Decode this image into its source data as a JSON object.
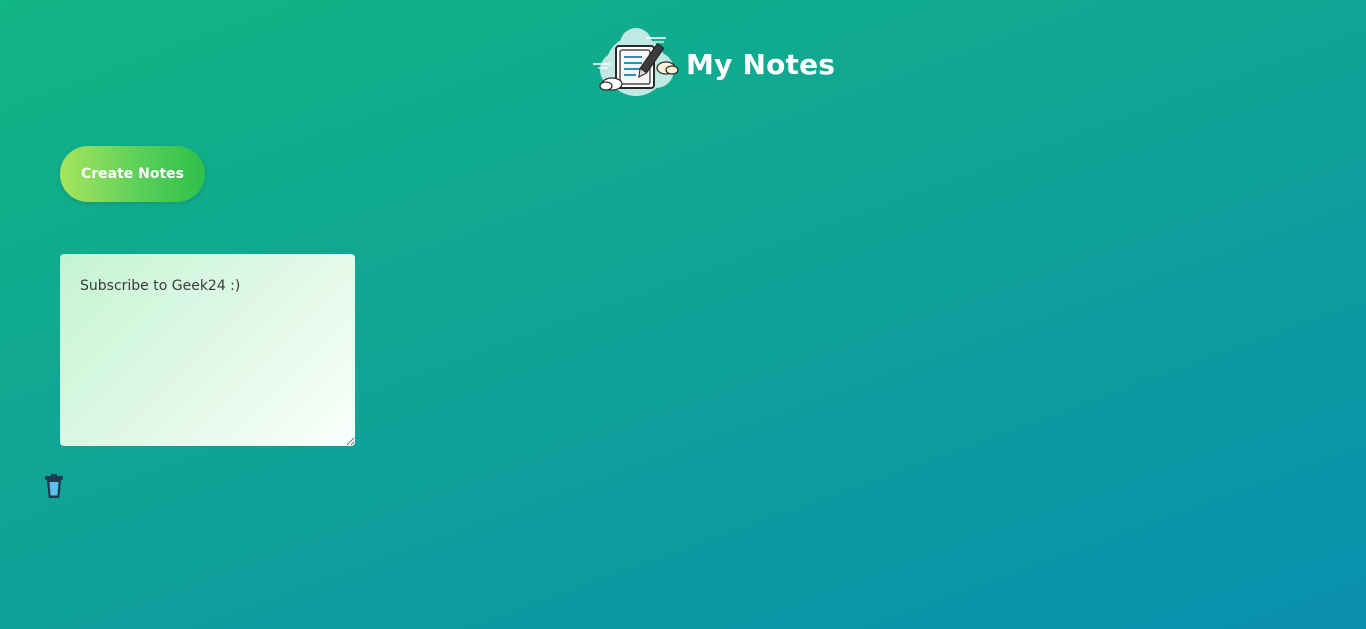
{
  "app": {
    "title": "My Notes",
    "logo_icon": "notes-cloud-logo-icon"
  },
  "toolbar": {
    "create_label": "Create Notes"
  },
  "notes": [
    {
      "text": "Subscribe to Geek24 :)",
      "delete_icon": "trash-icon"
    }
  ],
  "colors": {
    "background_start": "#12b584",
    "background_end": "#0a8faf",
    "button_start": "#a7e55c",
    "button_end": "#2ebf4a",
    "note_start": "#c4f4d2",
    "note_end": "#fbfffc",
    "trash_blue": "#5bc0eb"
  }
}
